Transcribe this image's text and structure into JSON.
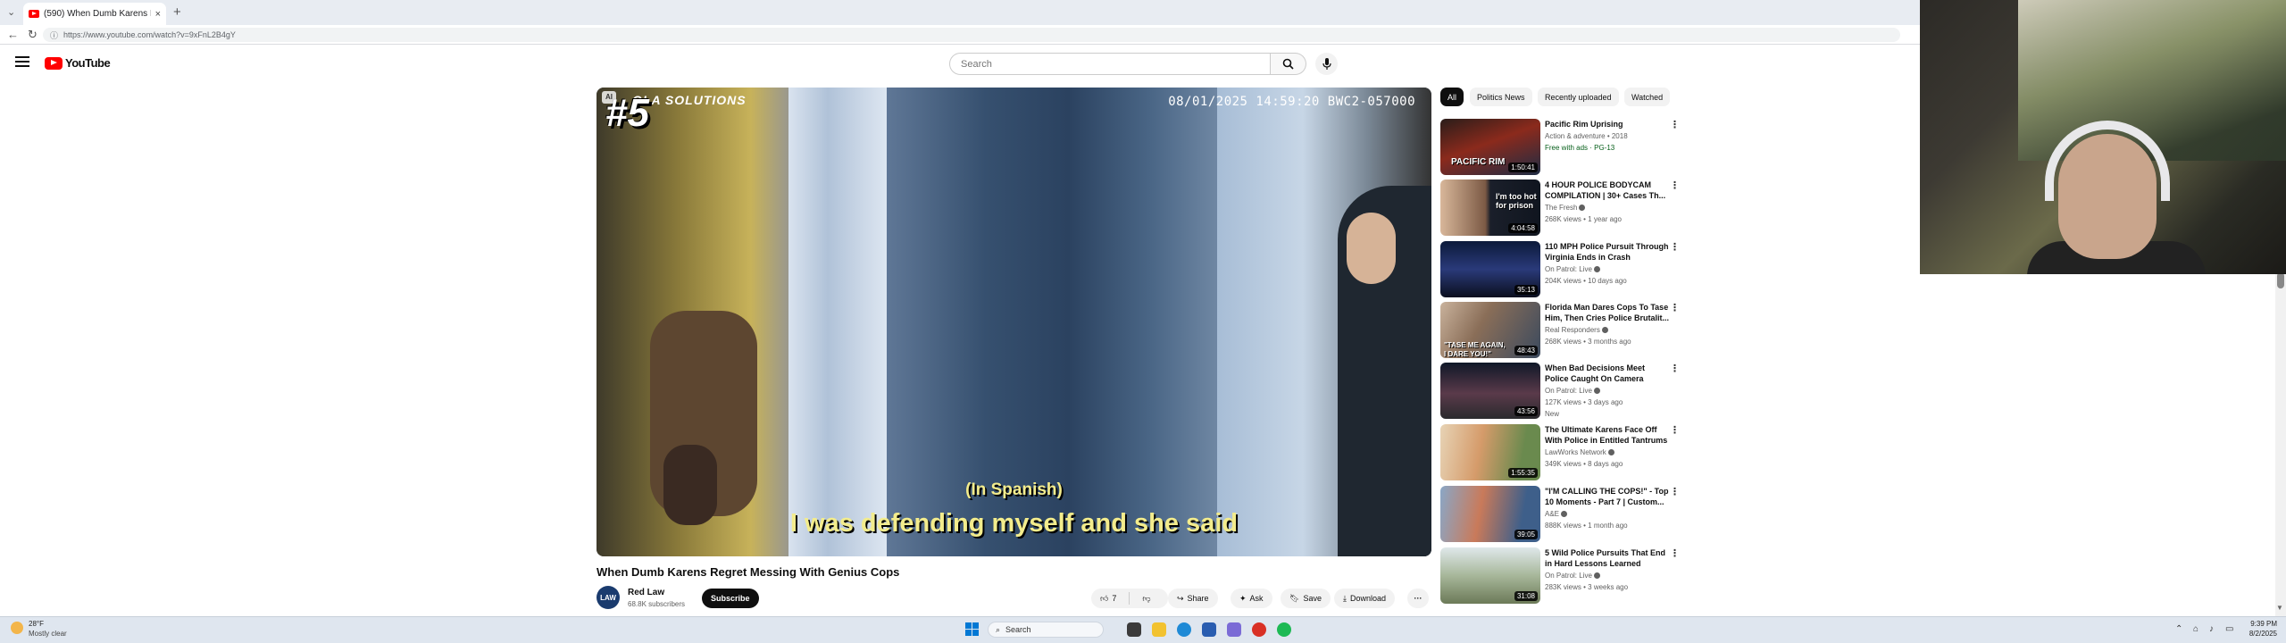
{
  "browser": {
    "tab_title": "(590) When Dumb Karens Re...",
    "tab_close": "×",
    "new_tab": "+",
    "tab_list": "⌄",
    "url": "https://www.youtube.com/watch?v=9xFnL2B4gY"
  },
  "masthead": {
    "logo_text": "YouTube",
    "search_placeholder": "Search"
  },
  "player": {
    "rank_overlay": "#5",
    "brand_overlay": "OLA SOLUTIONS",
    "badge": "AI",
    "timestamp_overlay": "08/01/2025 14:59:20 BWC2-057000",
    "subtitle_line1": "(In Spanish)",
    "subtitle_line2": "I was defending myself and she said"
  },
  "video": {
    "title": "When Dumb Karens Regret Messing With Genius Cops",
    "channel_avatar_text": "LAW",
    "channel_name": "Red Law",
    "channel_subs": "68.8K subscribers",
    "subscribe_label": "Subscribe",
    "like_count": "7",
    "share_label": "Share",
    "ask_label": "Ask",
    "save_label": "Save",
    "download_label": "Download",
    "more_label": "···"
  },
  "filters": [
    "All",
    "Politics News",
    "Recently uploaded",
    "Watched"
  ],
  "recommendations": [
    {
      "title": "Pacific Rim Uprising",
      "channel": "Action & adventure • 2018",
      "meta": "Free with ads · PG-13",
      "duration": "1:50:41",
      "thumb_text": "PACIFIC RIM",
      "verified": false
    },
    {
      "title": "4 HOUR POLICE BODYCAM COMPILATION | 30+ Cases Th...",
      "channel": "The Fresh",
      "meta": "268K views • 1 year ago",
      "duration": "4:04:58",
      "thumb_text": "I'm too hot for prison",
      "verified": true
    },
    {
      "title": "110 MPH Police Pursuit Through Virginia Ends in Crash",
      "channel": "On Patrol: Live",
      "meta": "204K views • 10 days ago",
      "duration": "35:13",
      "thumb_text": "",
      "verified": true
    },
    {
      "title": "Florida Man Dares Cops To Tase Him, Then Cries Police Brutalit...",
      "channel": "Real Responders",
      "meta": "268K views • 3 months ago",
      "duration": "48:43",
      "thumb_text": "\"TASE ME AGAIN, I DARE YOU!\"",
      "verified": true
    },
    {
      "title": "When Bad Decisions Meet Police Caught On Camera",
      "channel": "On Patrol: Live",
      "meta": "127K views • 3 days ago",
      "extra": "New",
      "duration": "43:56",
      "thumb_text": "",
      "verified": true
    },
    {
      "title": "The Ultimate Karens Face Off With Police in Entitled Tantrums",
      "channel": "LawWorks Network",
      "meta": "349K views • 8 days ago",
      "duration": "1:55:35",
      "thumb_text": "",
      "verified": true
    },
    {
      "title": "\"I'M CALLING THE COPS!\" - Top 10 Moments - Part 7 | Custom...",
      "channel": "A&E",
      "meta": "888K views • 1 month ago",
      "duration": "39:05",
      "thumb_text": "",
      "verified": true
    },
    {
      "title": "5 Wild Police Pursuits That End in Hard Lessons Learned",
      "channel": "On Patrol: Live",
      "meta": "283K views • 3 weeks ago",
      "duration": "31:08",
      "thumb_text": "",
      "verified": true
    }
  ],
  "taskbar": {
    "weather_temp": "28°F",
    "weather_desc": "Mostly clear",
    "search_label": "Search",
    "time": "9:39 PM",
    "date": "8/2/2025"
  },
  "colors": {
    "youtube_red": "#ff0000",
    "subtitle_yellow": "#f3ec8c",
    "taskbar": "#dfe6ef"
  }
}
